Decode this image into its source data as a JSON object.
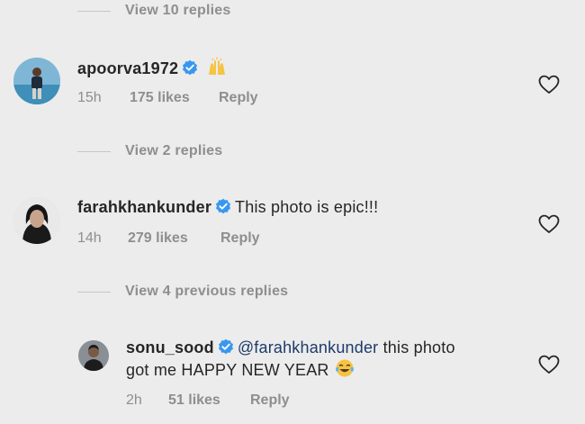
{
  "threads": {
    "top_view_replies": "View 10 replies",
    "mid_view_replies": "View 2 replies",
    "prev_view_replies": "View 4 previous replies"
  },
  "comments": [
    {
      "username": "apoorva1972",
      "text": "",
      "emoji": "raising-hands-emoji",
      "time": "15h",
      "likes": "175 likes",
      "reply": "Reply"
    },
    {
      "username": "farahkhankunder",
      "text": "This photo is epic!!!",
      "time": "14h",
      "likes": "279 likes",
      "reply": "Reply"
    },
    {
      "username": "sonu_sood",
      "mention": "@farahkhankunder",
      "text_after_mention": "this photo",
      "text_line2": "got me HAPPY NEW YEAR",
      "emoji": "tears-of-joy-emoji",
      "time": "2h",
      "likes": "51 likes",
      "reply": "Reply"
    }
  ],
  "colors": {
    "background": "#ececec",
    "verified": "#3897f0",
    "muted": "#8e8e8e",
    "mention": "#1d3b6b"
  }
}
